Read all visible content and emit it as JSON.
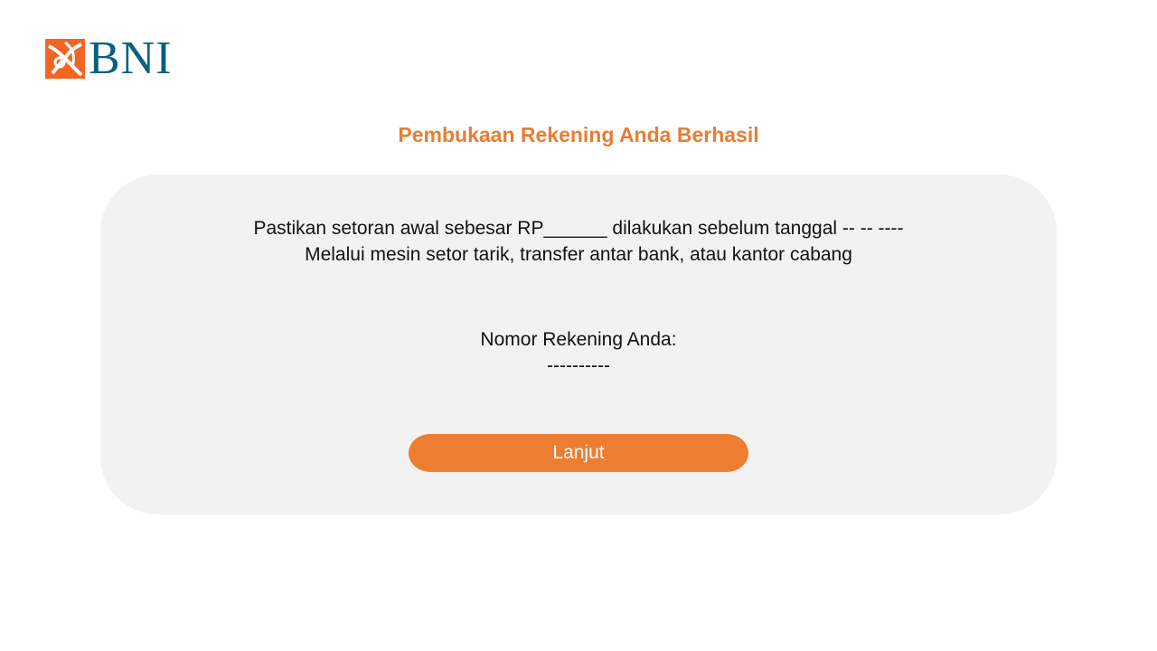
{
  "brand": {
    "logo_text": "BNI",
    "primary_color": "#0b6080",
    "accent_color": "#ed7d31",
    "logo_icon": "bni-46-icon"
  },
  "page": {
    "title": "Pembukaan Rekening Anda Berhasil"
  },
  "card": {
    "deposit_line": "Pastikan setoran awal sebesar RP______ dilakukan sebelum tanggal -- -- ----",
    "channels_line": "Melalui mesin setor tarik, transfer antar bank, atau kantor cabang",
    "account_label": "Nomor Rekening Anda:",
    "account_number": "----------",
    "continue_button": "Lanjut"
  }
}
